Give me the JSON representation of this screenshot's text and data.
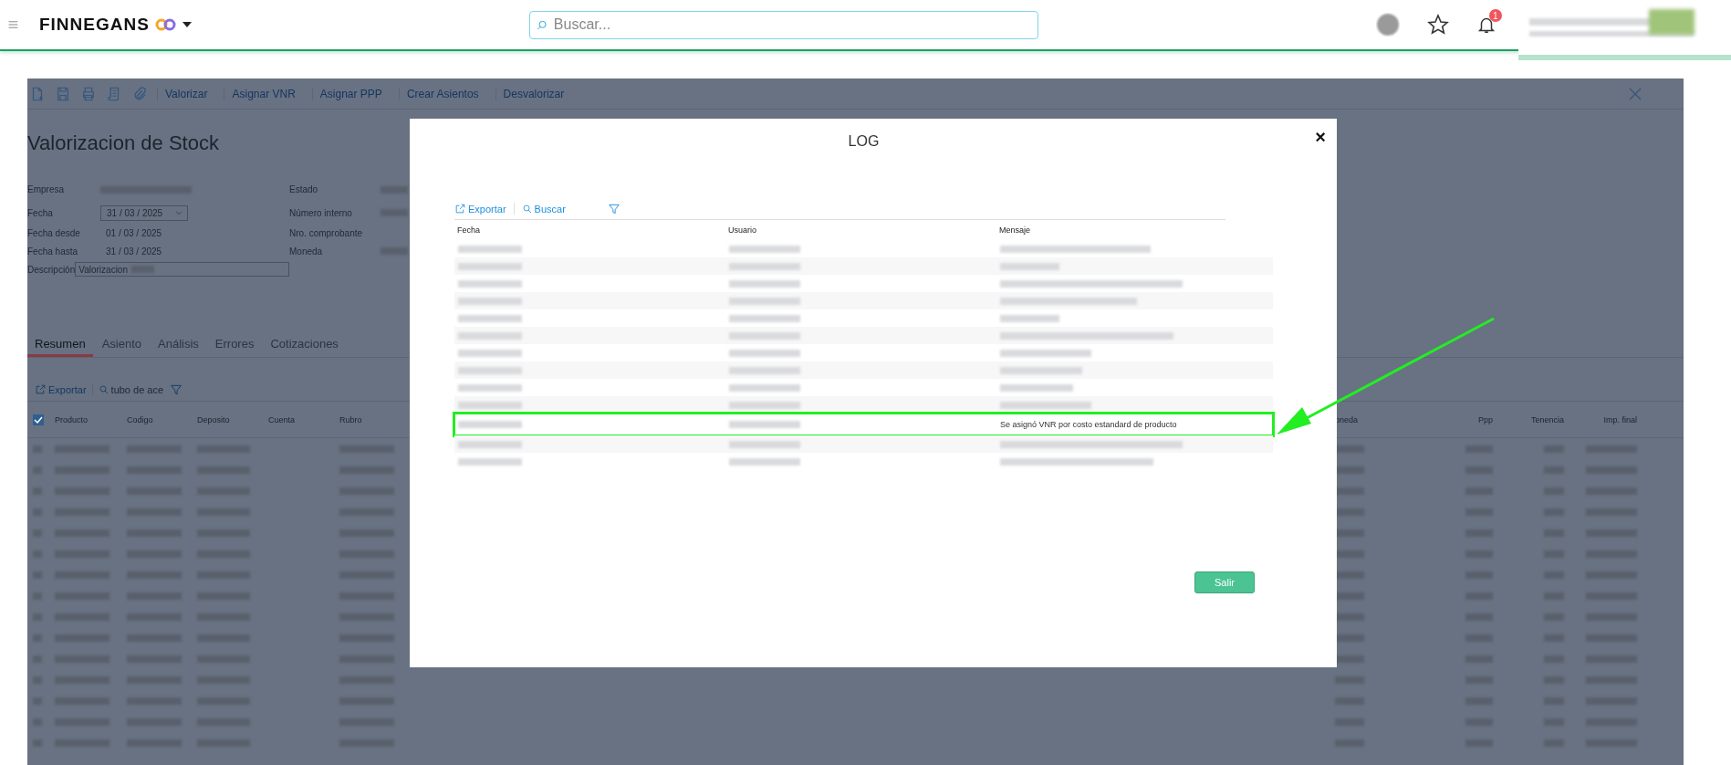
{
  "header": {
    "brand": "FINNEGANS",
    "search_placeholder": "Buscar...",
    "notification_count": "1"
  },
  "toolbar": {
    "actions": [
      "Valorizar",
      "Asignar VNR",
      "Asignar PPP",
      "Crear Asientos",
      "Desvalorizar"
    ]
  },
  "title": "Valorizacion de Stock",
  "form": {
    "left": [
      {
        "label": "Empresa",
        "kind": "redacted"
      },
      {
        "label": "Fecha",
        "kind": "date_picker",
        "value": "31 / 03 / 2025"
      },
      {
        "label": "Fecha desde",
        "kind": "date",
        "value": "01 / 03 / 2025"
      },
      {
        "label": "Fecha hasta",
        "kind": "date",
        "value": "31 / 03 / 2025"
      },
      {
        "label": "Descripción",
        "kind": "text",
        "value": "Valorizacion"
      }
    ],
    "right": [
      {
        "label": "Estado"
      },
      {
        "label": "Número interno"
      },
      {
        "label": "Nro. comprobante"
      },
      {
        "label": "Moneda"
      }
    ]
  },
  "tabs": [
    {
      "label": "Resumen",
      "selected": true
    },
    {
      "label": "Asiento",
      "selected": false
    },
    {
      "label": "Análisis",
      "selected": false
    },
    {
      "label": "Errores",
      "selected": false
    },
    {
      "label": "Cotizaciones",
      "selected": false
    }
  ],
  "grid": {
    "export_label": "Exportar",
    "search_value": "tubo de ace",
    "select_all_checked": true,
    "columns_left": [
      "Producto",
      "Codigo",
      "Deposito",
      "Cuenta",
      "Rubro"
    ],
    "columns_right": [
      "oneda",
      "Ppp",
      "Tenencia",
      "Imp. final"
    ]
  },
  "log_dialog": {
    "title": "LOG",
    "close": "×",
    "export_label": "Exportar",
    "search_label": "Buscar",
    "columns": [
      "Fecha",
      "Usuario",
      "Mensaje"
    ],
    "rows": [
      {
        "highlighted": false
      },
      {
        "highlighted": false
      },
      {
        "highlighted": false
      },
      {
        "highlighted": false
      },
      {
        "highlighted": false
      },
      {
        "highlighted": false
      },
      {
        "highlighted": false
      },
      {
        "highlighted": false
      },
      {
        "highlighted": false
      },
      {
        "highlighted": false
      },
      {
        "highlighted": true,
        "message": "Se asignó VNR por costo estandard de producto"
      },
      {
        "highlighted": false
      },
      {
        "highlighted": false
      }
    ],
    "button": "Salir"
  }
}
